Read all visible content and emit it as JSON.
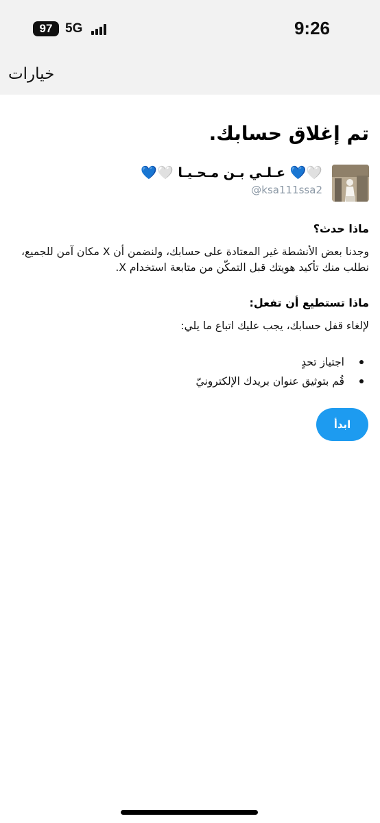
{
  "status_bar": {
    "battery": "97",
    "network": "5G",
    "time": "9:26"
  },
  "nav": {
    "title": "خيارات"
  },
  "page": {
    "title": "تم إغلاق حسابك.",
    "account": {
      "display_name": "🤍💙 عـلـي بـن مـحـيـا 🤍💙",
      "handle": "@ksa111ssa2"
    },
    "what_happened": {
      "heading": "ماذا حدث؟",
      "body": "وجدنا بعض الأنشطة غير المعتادة على حسابك، ولنضمن أن X مكان آمن للجميع، نطلب منك تأكيد هويتك قبل التمكّن من متابعة استخدام X."
    },
    "what_to_do": {
      "heading": "ماذا تستطيع أن تفعل:",
      "body": "لإلغاء قفل حسابك، يجب عليك اتباع ما يلي:",
      "steps": [
        "اجتياز تحدٍ",
        "قُم بتوثيق عنوان بريدك الإلكترونيّ"
      ]
    },
    "start_button": "ابدأ"
  },
  "colors": {
    "accent": "#1d9bf0",
    "header_bg": "#f2f2f2",
    "handle_gray": "#8b98a5"
  }
}
